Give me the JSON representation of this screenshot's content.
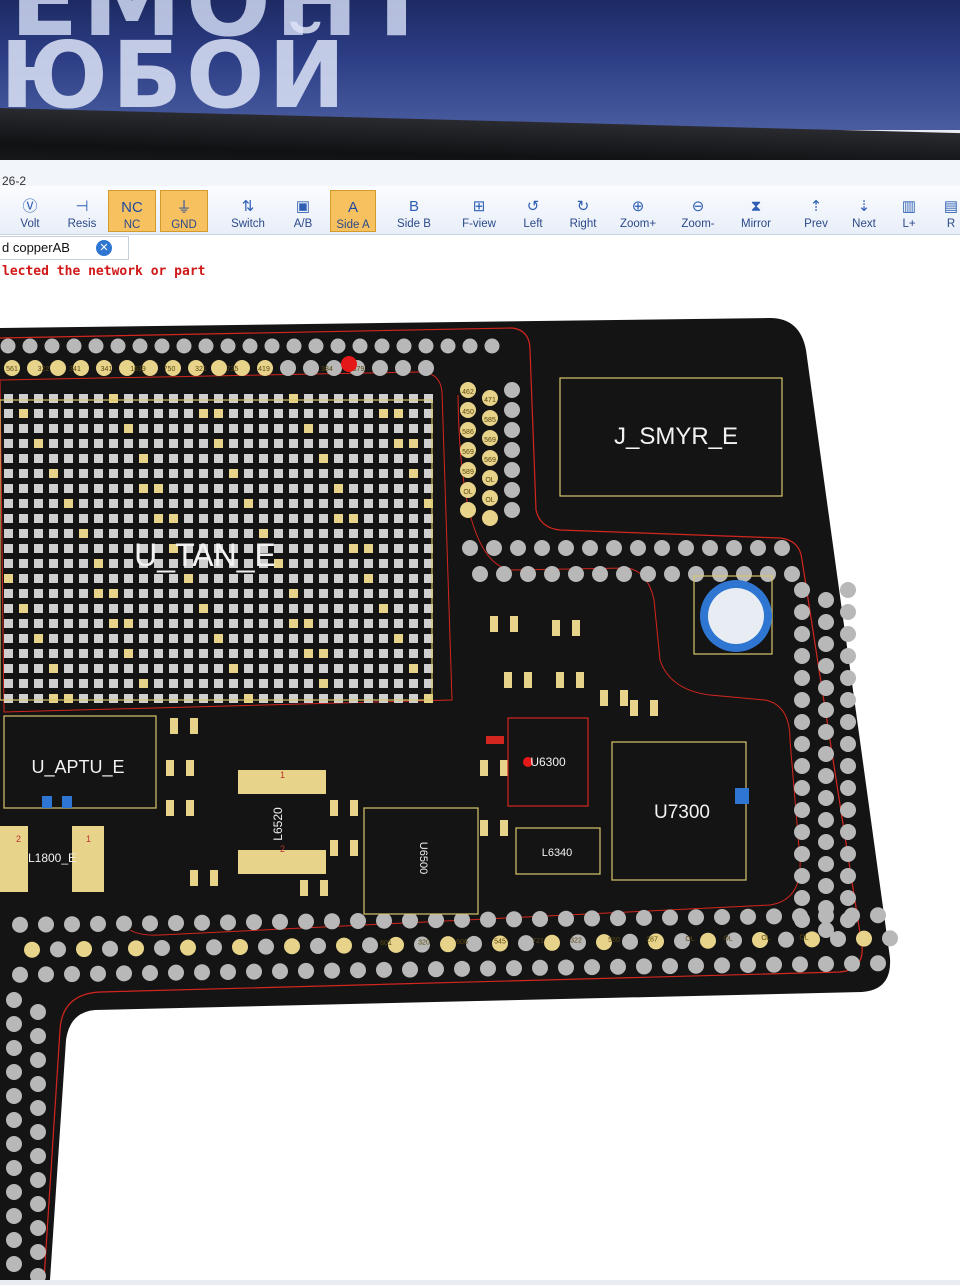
{
  "wall": {
    "line1": "ЕМОНТ",
    "line2": "ЮБОЙ"
  },
  "window": {
    "title": "26-2"
  },
  "toolbar": {
    "buttons": [
      {
        "label": "Volt",
        "icon": "volt-icon",
        "glyph": "Ⓥ"
      },
      {
        "label": "Resis",
        "icon": "resistance-icon",
        "glyph": "⊣"
      },
      {
        "label": "NC",
        "icon": "nc-icon",
        "glyph": "NC"
      },
      {
        "label": "GND",
        "icon": "ground-icon",
        "glyph": "⏚"
      },
      {
        "label": "Switch",
        "icon": "switch-icon",
        "glyph": "⇅"
      },
      {
        "label": "A/B",
        "icon": "ab-icon",
        "glyph": "▣"
      },
      {
        "label": "Side A",
        "icon": "side-a-icon",
        "glyph": "A"
      },
      {
        "label": "Side B",
        "icon": "side-b-icon",
        "glyph": "B"
      },
      {
        "label": "F-view",
        "icon": "fview-icon",
        "glyph": "⊞"
      },
      {
        "label": "Left",
        "icon": "rotate-left-icon",
        "glyph": "↺"
      },
      {
        "label": "Right",
        "icon": "rotate-right-icon",
        "glyph": "↻"
      },
      {
        "label": "Zoom+",
        "icon": "zoom-in-icon",
        "glyph": "⊕"
      },
      {
        "label": "Zoom-",
        "icon": "zoom-out-icon",
        "glyph": "⊖"
      },
      {
        "label": "Mirror",
        "icon": "mirror-icon",
        "glyph": "⧗"
      },
      {
        "label": "Prev",
        "icon": "prev-icon",
        "glyph": "⇡"
      },
      {
        "label": "Next",
        "icon": "next-icon",
        "glyph": "⇣"
      },
      {
        "label": "L+",
        "icon": "layer-plus-icon",
        "glyph": "▥"
      },
      {
        "label": "R",
        "icon": "r-icon",
        "glyph": "▤"
      }
    ]
  },
  "tab": {
    "label": "d copperAB"
  },
  "status": {
    "text": "lected the network or part"
  },
  "board": {
    "components": [
      "J_SMYR_E",
      "U_TAN_E",
      "U_APTU_E",
      "U7300",
      "U6300",
      "L6520",
      "U6500",
      "L6340",
      "L1800_E"
    ],
    "pad_labels_top": [
      "561",
      "322",
      "341",
      "341",
      "1639",
      "750",
      "321",
      "735",
      "419",
      "",
      "384",
      "379"
    ],
    "pad_labels_side": [
      "462",
      "471",
      "450",
      "585",
      "586",
      "569",
      "569",
      "569",
      "589",
      "OL",
      "OL",
      "OL"
    ],
    "pad_labels_bottom": [
      "601",
      "320",
      "606",
      "545",
      "721",
      "322",
      "550",
      "287",
      "OL",
      "OL",
      "OL",
      "OL"
    ],
    "pin_marks": [
      "1",
      "2",
      "1",
      "2",
      "2",
      "1"
    ]
  },
  "colors": {
    "board": "#141414",
    "pad": "#e8d38a",
    "via": "#b8b8b8",
    "outline": "#d3261f",
    "silk": "#f0f0f0",
    "accent": "#2f76d2"
  }
}
